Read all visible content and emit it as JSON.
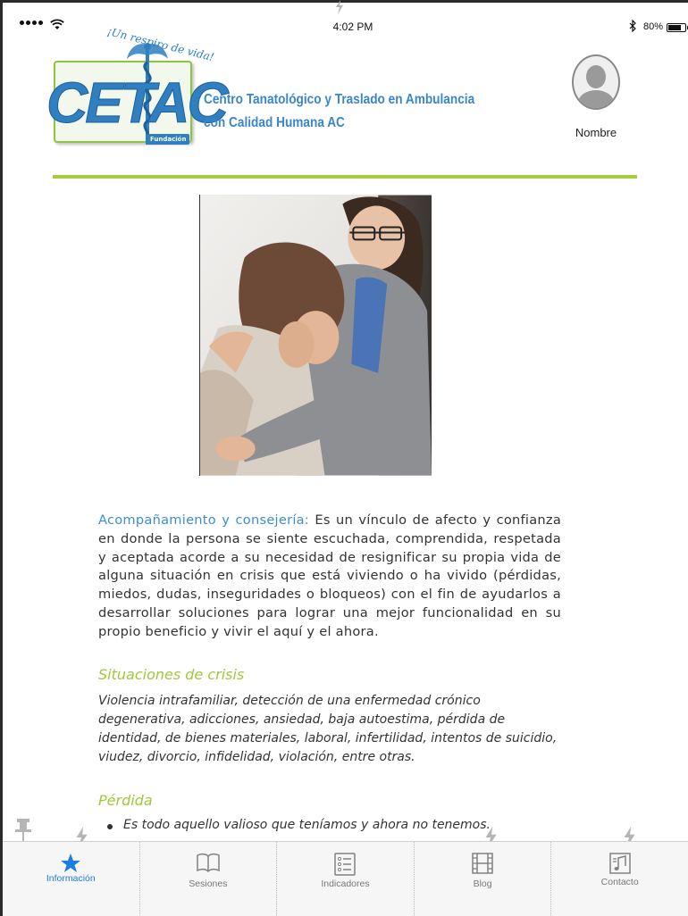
{
  "status_bar": {
    "time": "4:02 PM",
    "battery": "80%"
  },
  "header": {
    "logo": {
      "slogan": "¡Un respiro de vida!",
      "name": "CETAC",
      "badge": "Fundación"
    },
    "org_name_line1": "Centro Tanatológico y Traslado en Ambulancia",
    "org_name_line2": "con Calidad Humana AC",
    "profile_label": "Nombre"
  },
  "colors": {
    "accent_green": "#a8cd3c",
    "accent_blue": "#3b8fd0",
    "tab_active": "#1a7fe0"
  },
  "content": {
    "intro_term": "Acompañamiento y consejería:",
    "intro_text": "Es un vínculo de afecto y confianza en donde la persona se siente escuchada, comprendida, respetada y aceptada acorde a su necesidad de resignificar su propia vida de alguna situación en crisis que está viviendo o ha vivido (pérdidas, miedos, dudas, inseguridades o bloqueos) con el fin de ayudarlos a desarrollar soluciones para lograr una mejor funcionalidad en su propio beneficio y vivir el aquí y el ahora.",
    "section1_title": "Situaciones de crisis",
    "section1_body": "Violencia intrafamiliar, detección de una enfermedad crónico degenerativa, adicciones, ansiedad, baja autoestima, pérdida de identidad, de bienes materiales, laboral, infertilidad, intentos de suicidio, viudez, divorcio, infidelidad, violación, entre otras.",
    "section2_title": "Pérdida",
    "section2_bullets": [
      "Es todo aquello valioso que teníamos y ahora no tenemos."
    ]
  },
  "tabs": [
    {
      "label": "Información",
      "icon": "star-icon",
      "active": true
    },
    {
      "label": "Sesiones",
      "icon": "book-icon",
      "active": false
    },
    {
      "label": "Indicadores",
      "icon": "checklist-icon",
      "active": false
    },
    {
      "label": "Blog",
      "icon": "film-icon",
      "active": false
    },
    {
      "label": "Contacto",
      "icon": "music-note-icon",
      "active": false
    }
  ]
}
